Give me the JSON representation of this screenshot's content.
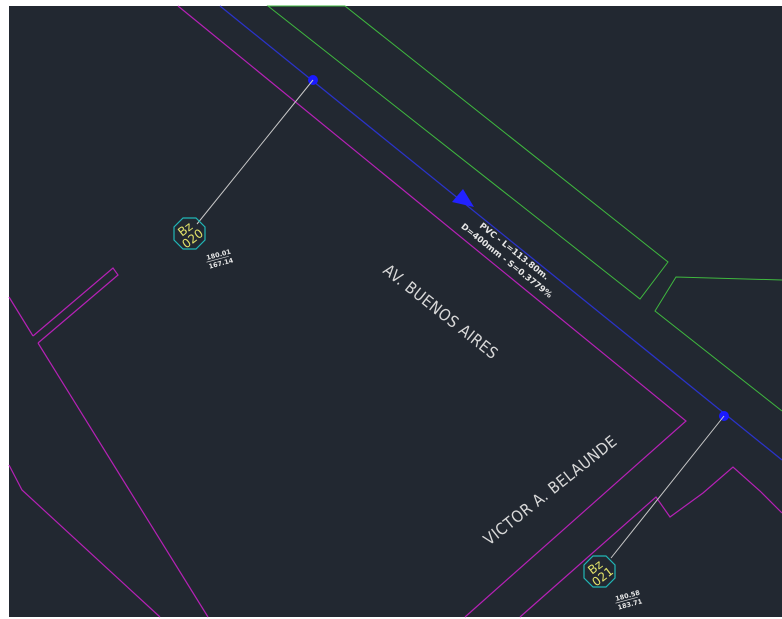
{
  "colors": {
    "background": "#222831",
    "frame": "#ffffff",
    "property_line": "#b521b5",
    "curb_line": "#3fb83f",
    "sewer_pipe": "#2a33c8",
    "sewer_node": "#1a1aff",
    "leader": "#c9c9c9",
    "manhole_outline": "#21b6b6",
    "manhole_text": "#e3e36a",
    "label_text": "#e6e6e6"
  },
  "pipe": {
    "label_line1": "PVC  -  L=113.80m.",
    "label_line2": "D=400mm  -  S=0.3779%",
    "flow_arrow_icon": "flow-direction-arrow"
  },
  "manholes": [
    {
      "id_line1": "Bz",
      "id_line2": "020",
      "elev_top": "180.01",
      "elev_bottom": "167.14"
    },
    {
      "id_line1": "Bz",
      "id_line2": "021",
      "elev_top": "180.58",
      "elev_bottom": "183.71"
    }
  ],
  "streets": {
    "street_1": "AV. BUENOS AIRES",
    "street_2": "VICTOR A. BELAUNDE"
  }
}
